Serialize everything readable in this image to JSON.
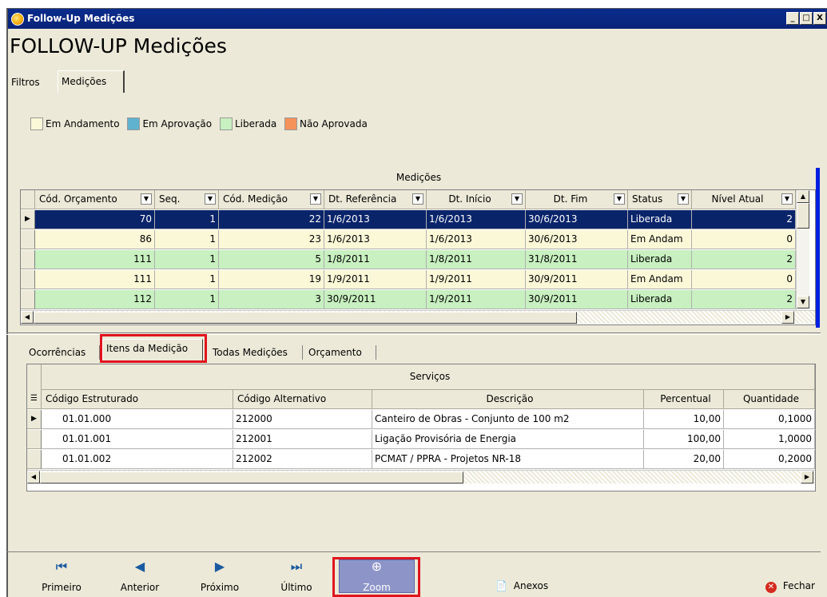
{
  "window": {
    "title": "Follow-Up Medições",
    "controls": [
      "_",
      "□",
      "X"
    ]
  },
  "page_title": "FOLLOW-UP Medições",
  "top_tabs": [
    {
      "label": "Filtros"
    },
    {
      "label": "Medições"
    }
  ],
  "legend": [
    {
      "label": "Em Andamento",
      "color": "#fbf8d8"
    },
    {
      "label": "Em Aprovação",
      "color": "#5fb3cf"
    },
    {
      "label": "Liberada",
      "color": "#c8f0c0"
    },
    {
      "label": "Não Aprovada",
      "color": "#f4925a"
    }
  ],
  "medicoes_grid": {
    "caption": "Medições",
    "columns": [
      "Cód. Orçamento",
      "Seq.",
      "Cód. Medição",
      "Dt. Referência",
      "Dt. Início",
      "Dt. Fim",
      "Status",
      "Nível Atual"
    ],
    "rows": [
      {
        "cod_orcamento": "70",
        "seq": "1",
        "cod_medicao": "22",
        "dt_referencia": "1/6/2013",
        "dt_inicio": "1/6/2013",
        "dt_fim": "30/6/2013",
        "status": "Liberada",
        "nivel": "2",
        "color": "#c8f0c0"
      },
      {
        "cod_orcamento": "86",
        "seq": "1",
        "cod_medicao": "23",
        "dt_referencia": "1/6/2013",
        "dt_inicio": "1/6/2013",
        "dt_fim": "30/6/2013",
        "status": "Em Andam",
        "nivel": "0",
        "color": "#fbf8d8"
      },
      {
        "cod_orcamento": "111",
        "seq": "1",
        "cod_medicao": "5",
        "dt_referencia": "1/8/2011",
        "dt_inicio": "1/8/2011",
        "dt_fim": "31/8/2011",
        "status": "Liberada",
        "nivel": "2",
        "color": "#c8f0c0"
      },
      {
        "cod_orcamento": "111",
        "seq": "1",
        "cod_medicao": "19",
        "dt_referencia": "1/9/2011",
        "dt_inicio": "1/9/2011",
        "dt_fim": "30/9/2011",
        "status": "Em Andam",
        "nivel": "0",
        "color": "#fbf8d8"
      },
      {
        "cod_orcamento": "112",
        "seq": "1",
        "cod_medicao": "3",
        "dt_referencia": "30/9/2011",
        "dt_inicio": "1/9/2011",
        "dt_fim": "30/9/2011",
        "status": "Liberada",
        "nivel": "2",
        "color": "#c8f0c0"
      }
    ]
  },
  "bottom_tabs": [
    {
      "label": "Ocorrências"
    },
    {
      "label": "Itens da Medição"
    },
    {
      "label": "Todas Medições"
    },
    {
      "label": "Orçamento"
    }
  ],
  "servicos_grid": {
    "band_caption": "Serviços",
    "columns": [
      "Código Estruturado",
      "Código Alternativo",
      "Descrição",
      "Percentual",
      "Quantidade"
    ],
    "rows": [
      {
        "codigo_estruturado": "01.01.000",
        "codigo_alternativo": "212000",
        "descricao": "Canteiro de Obras - Conjunto de 100 m2",
        "percentual": "10,00",
        "quantidade": "0,1000"
      },
      {
        "codigo_estruturado": "01.01.001",
        "codigo_alternativo": "212001",
        "descricao": "Ligação Provisória de Energia",
        "percentual": "100,00",
        "quantidade": "1,0000"
      },
      {
        "codigo_estruturado": "01.01.002",
        "codigo_alternativo": "212002",
        "descricao": "PCMAT / PPRA - Projetos NR-18",
        "percentual": "20,00",
        "quantidade": "0,2000"
      }
    ]
  },
  "toolbar": {
    "primeiro": "Primeiro",
    "anterior": "Anterior",
    "proximo": "Próximo",
    "ultimo": "Último",
    "zoom": "Zoom",
    "anexos": "Anexos",
    "fechar": "Fechar"
  }
}
